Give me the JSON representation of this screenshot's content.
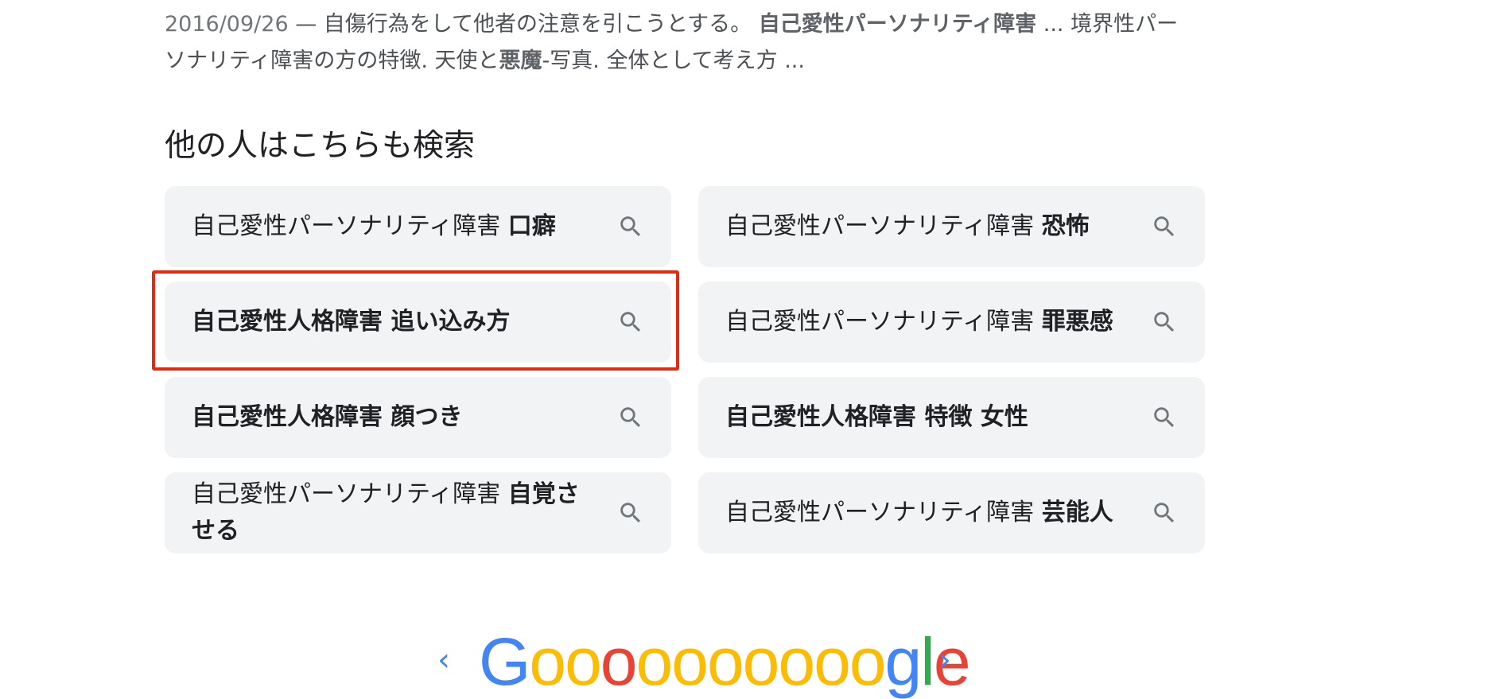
{
  "snippet": {
    "date": "2016/09/26",
    "part1": " — 自傷行為をして他者の注意を引こうとする。 ",
    "bold1": "自己愛性パーソナリティ障害",
    "part2": " ... 境界性パー",
    "line2_part1": "ソナリティ障害の方の特徴. 天使と",
    "bold2": "悪魔",
    "line2_part2": "-写真. 全体として考え方 ..."
  },
  "section_title": "他の人はこちらも検索",
  "related_searches": [
    {
      "prefix": "自己愛性パーソナリティ障害 ",
      "bold": "口癖"
    },
    {
      "prefix": "自己愛性パーソナリティ障害 ",
      "bold": "恐怖"
    },
    {
      "prefix": "",
      "bold": "自己愛性人格障害 追い込み方"
    },
    {
      "prefix": "自己愛性パーソナリティ障害 ",
      "bold": "罪悪感"
    },
    {
      "prefix": "",
      "bold": "自己愛性人格障害 顔つき"
    },
    {
      "prefix": "",
      "bold": "自己愛性人格障害 特徴 女性"
    },
    {
      "prefix": "自己愛性パーソナリティ障害 ",
      "bold": "自覚させる"
    },
    {
      "prefix": "自己愛性パーソナリティ障害 ",
      "bold": "芸能人"
    }
  ],
  "pager": {
    "prev_glyph": "‹",
    "next_glyph": "›",
    "logo_letters": [
      "G",
      "o",
      "o",
      "o",
      "o",
      "o",
      "o",
      "o",
      "o",
      "o",
      "o",
      "g",
      "l",
      "e"
    ]
  },
  "colors": {
    "highlight": "#e8290b",
    "chip_bg": "#f1f3f4",
    "icon": "#70757a",
    "logo": [
      "#4285f4",
      "#fbbc05",
      "#fbbc05",
      "#ea4335",
      "#fbbc05",
      "#fbbc05",
      "#fbbc05",
      "#fbbc05",
      "#fbbc05",
      "#fbbc05",
      "#fbbc05",
      "#4285f4",
      "#34a853",
      "#ea4335"
    ]
  }
}
